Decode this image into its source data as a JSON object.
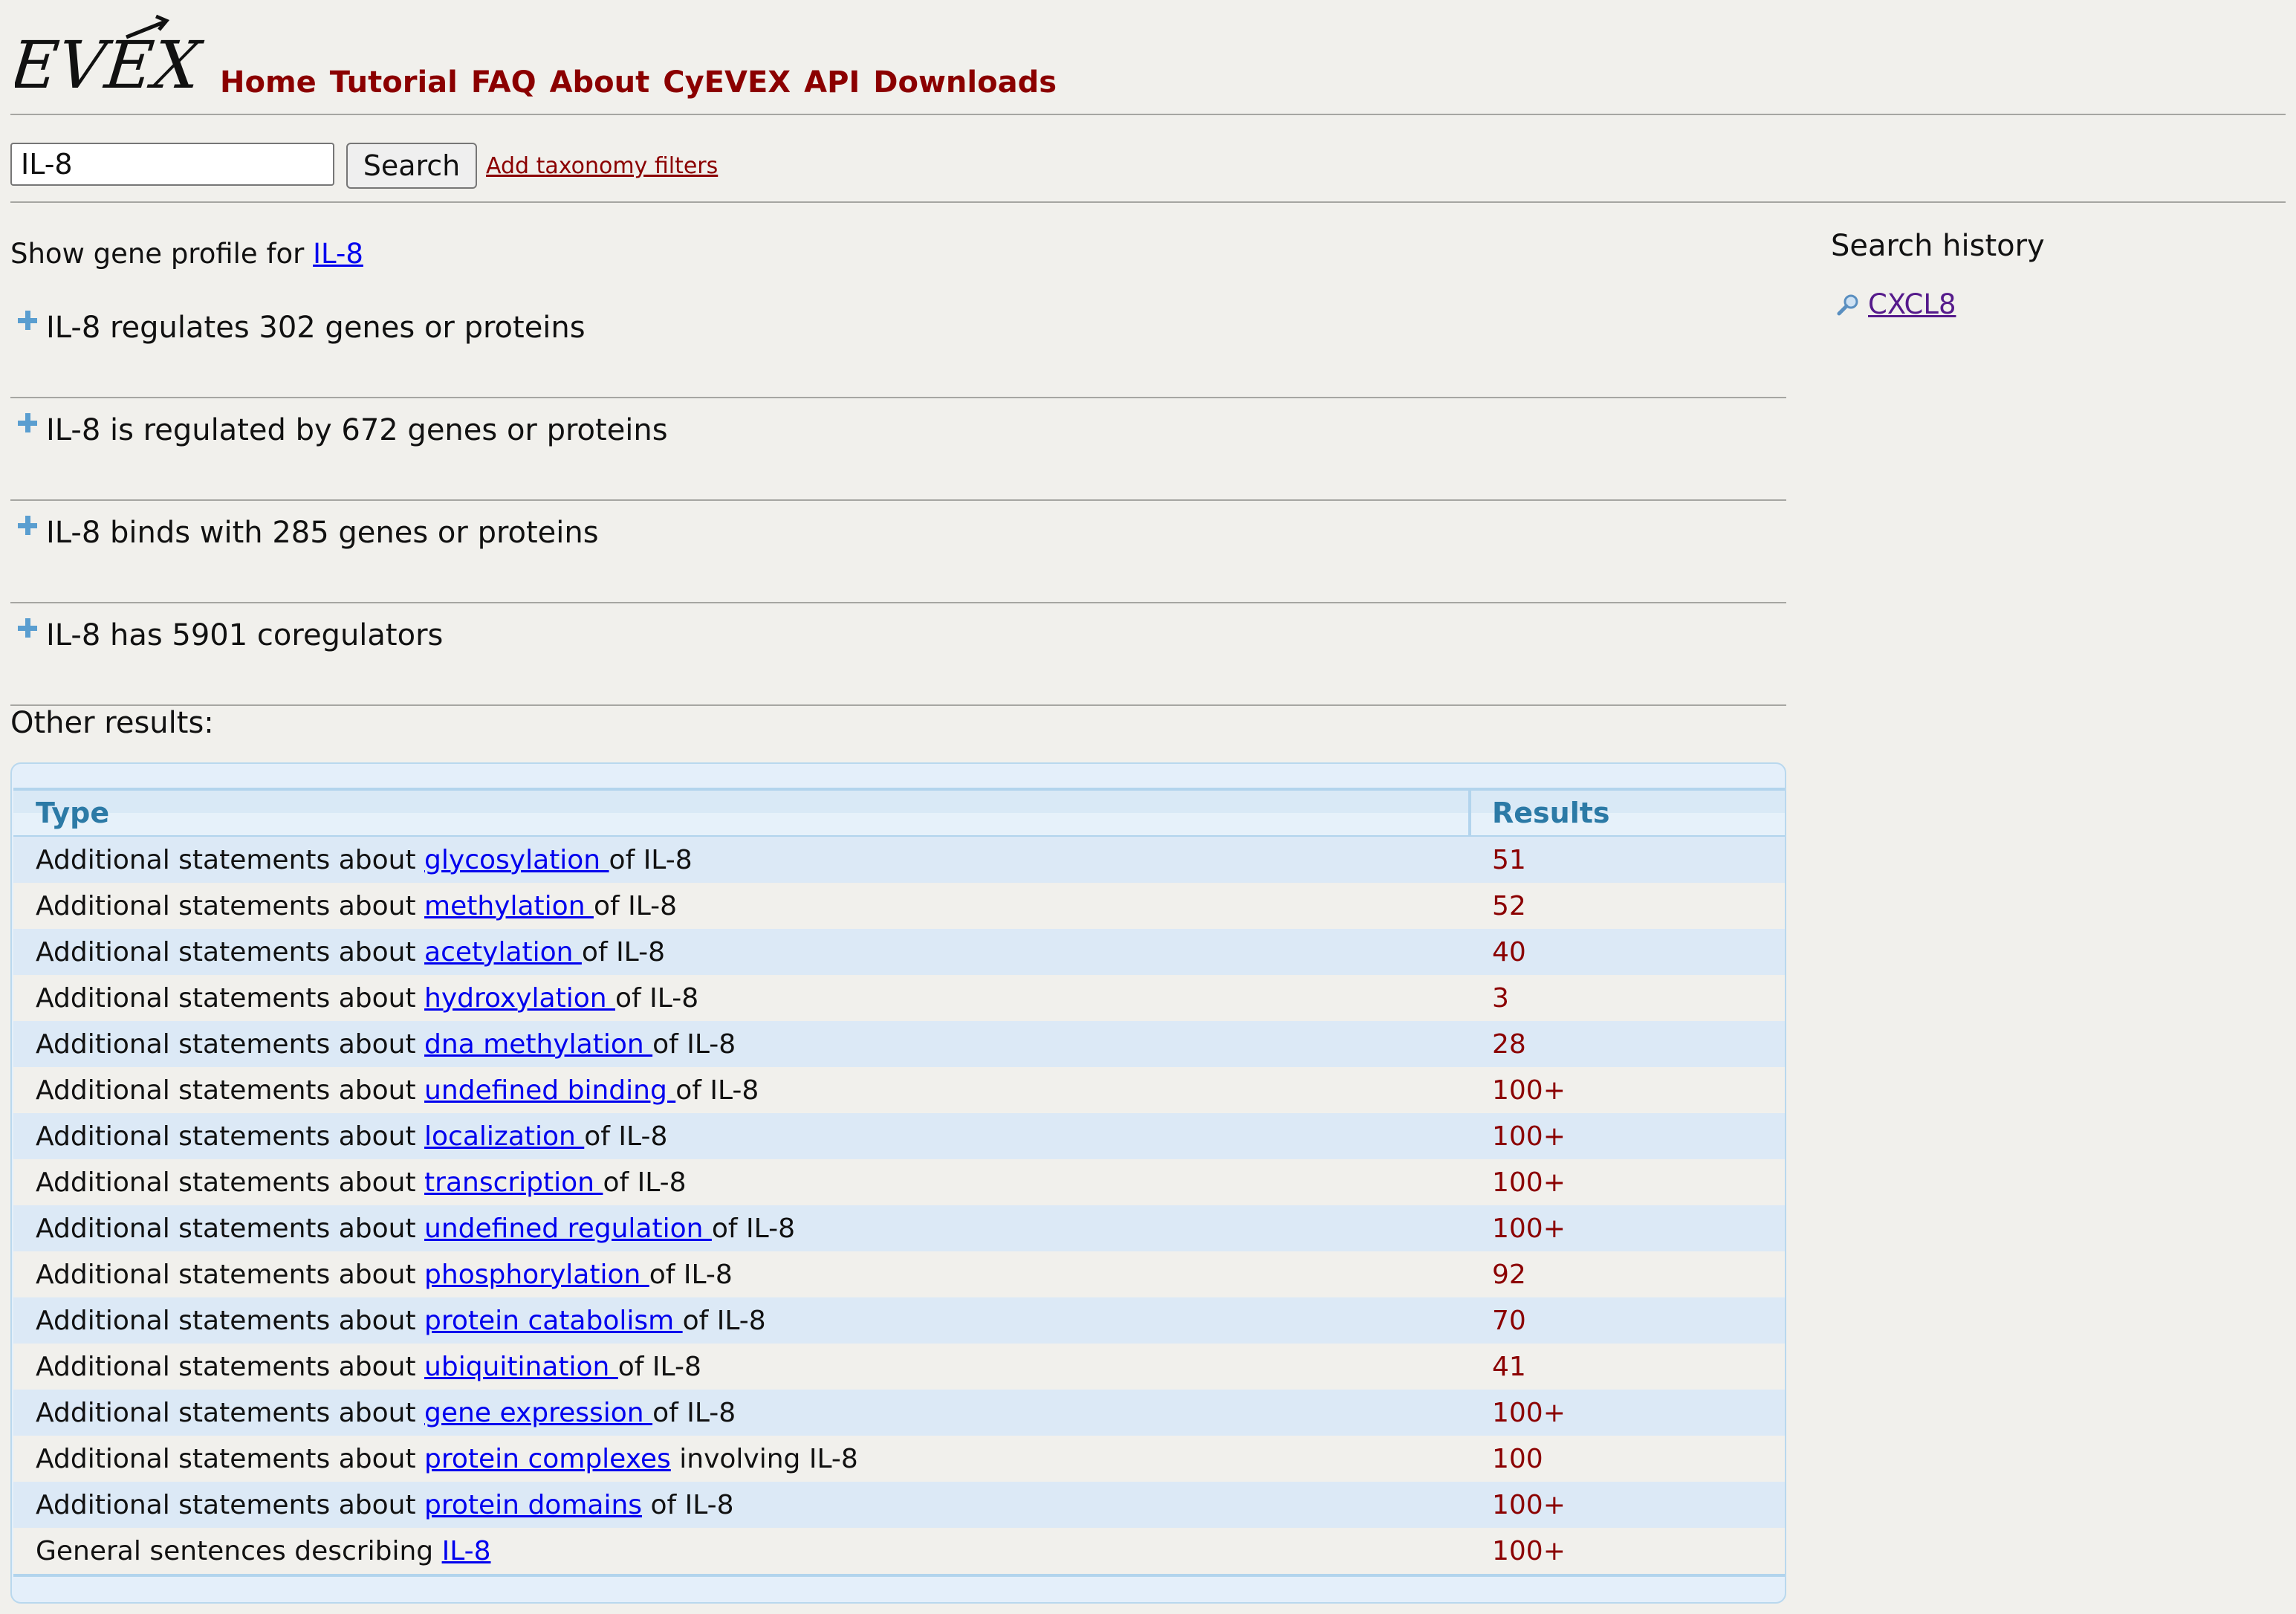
{
  "logo": {
    "text": "EVEX"
  },
  "nav": {
    "items": [
      "Home",
      "Tutorial",
      "FAQ",
      "About",
      "CyEVEX",
      "API",
      "Downloads"
    ]
  },
  "search": {
    "value": "IL-8",
    "button_label": "Search",
    "taxonomy_link": "Add taxonomy filters"
  },
  "gene_profile": {
    "prefix": "Show gene profile for",
    "link": "IL-8"
  },
  "sections": [
    "IL-8 regulates 302 genes or proteins",
    "IL-8 is regulated by 672 genes or proteins",
    "IL-8 binds with 285 genes or proteins",
    "IL-8 has 5901 coregulators"
  ],
  "other_results": {
    "title": "Other results:",
    "columns": [
      "Type",
      "Results"
    ],
    "rows": [
      {
        "prefix": "Additional statements about ",
        "link": "glycosylation ",
        "suffix": "of IL-8",
        "count": "51"
      },
      {
        "prefix": "Additional statements about ",
        "link": "methylation ",
        "suffix": "of IL-8",
        "count": "52"
      },
      {
        "prefix": "Additional statements about ",
        "link": "acetylation ",
        "suffix": "of IL-8",
        "count": "40"
      },
      {
        "prefix": "Additional statements about ",
        "link": "hydroxylation ",
        "suffix": "of IL-8",
        "count": "3"
      },
      {
        "prefix": "Additional statements about ",
        "link": "dna methylation ",
        "suffix": "of IL-8",
        "count": "28"
      },
      {
        "prefix": "Additional statements about ",
        "link": "undefined binding ",
        "suffix": "of IL-8",
        "count": "100+"
      },
      {
        "prefix": "Additional statements about ",
        "link": "localization ",
        "suffix": "of IL-8",
        "count": "100+"
      },
      {
        "prefix": "Additional statements about ",
        "link": "transcription ",
        "suffix": "of IL-8",
        "count": "100+"
      },
      {
        "prefix": "Additional statements about ",
        "link": "undefined regulation ",
        "suffix": "of IL-8",
        "count": "100+"
      },
      {
        "prefix": "Additional statements about ",
        "link": "phosphorylation ",
        "suffix": "of IL-8",
        "count": "92"
      },
      {
        "prefix": "Additional statements about ",
        "link": "protein catabolism ",
        "suffix": "of IL-8",
        "count": "70"
      },
      {
        "prefix": "Additional statements about ",
        "link": "ubiquitination ",
        "suffix": "of IL-8",
        "count": "41"
      },
      {
        "prefix": "Additional statements about ",
        "link": "gene expression ",
        "suffix": "of IL-8",
        "count": "100+"
      },
      {
        "prefix": "Additional statements about ",
        "link": "protein complexes",
        "suffix": " involving IL-8",
        "count": "100"
      },
      {
        "prefix": "Additional statements about ",
        "link": "protein domains",
        "suffix": " of IL-8",
        "count": "100+"
      },
      {
        "prefix": "General sentences describing ",
        "link": "IL-8",
        "suffix": "",
        "count": "100+"
      }
    ]
  },
  "sidebar": {
    "title": "Search history",
    "items": [
      {
        "icon": "magnifier-icon",
        "label": "CXCL8"
      }
    ]
  },
  "colors": {
    "nav": "#8b0000",
    "link": "#0000ee",
    "visited_link": "#551a8b",
    "count": "#8b0000",
    "table_header": "#2c7aa6",
    "row_alt": "#dce9f6",
    "background": "#f1f0ec"
  }
}
